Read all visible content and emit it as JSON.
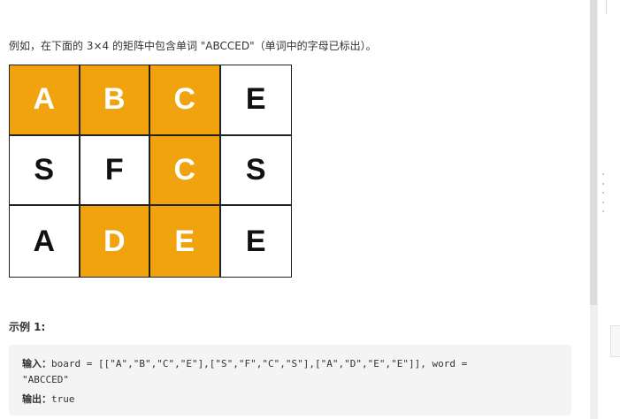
{
  "intro_text": "例如，在下面的 3×4 的矩阵中包含单词 \"ABCCED\"（单词中的字母已标出）。",
  "grid": {
    "rows": [
      [
        {
          "letter": "A",
          "highlighted": true
        },
        {
          "letter": "B",
          "highlighted": true
        },
        {
          "letter": "C",
          "highlighted": true
        },
        {
          "letter": "E",
          "highlighted": false
        }
      ],
      [
        {
          "letter": "S",
          "highlighted": false
        },
        {
          "letter": "F",
          "highlighted": false
        },
        {
          "letter": "C",
          "highlighted": true
        },
        {
          "letter": "S",
          "highlighted": false
        }
      ],
      [
        {
          "letter": "A",
          "highlighted": false
        },
        {
          "letter": "D",
          "highlighted": true
        },
        {
          "letter": "E",
          "highlighted": true
        },
        {
          "letter": "E",
          "highlighted": false
        }
      ]
    ],
    "highlight_color": "#f0a30c",
    "cell_color": "#ffffff"
  },
  "example": {
    "title": "示例 1:",
    "input_label": "输入：",
    "input_value_line1": "board = [[\"A\",\"B\",\"C\",\"E\"],[\"S\",\"F\",\"C\",\"S\"],[\"A\",\"D\",\"E\",\"E\"]], word =",
    "input_value_line2": "\"ABCCED\"",
    "output_label": "输出：",
    "output_value": "true"
  },
  "icons": {
    "drag_handle": "drag-handle-icon"
  }
}
